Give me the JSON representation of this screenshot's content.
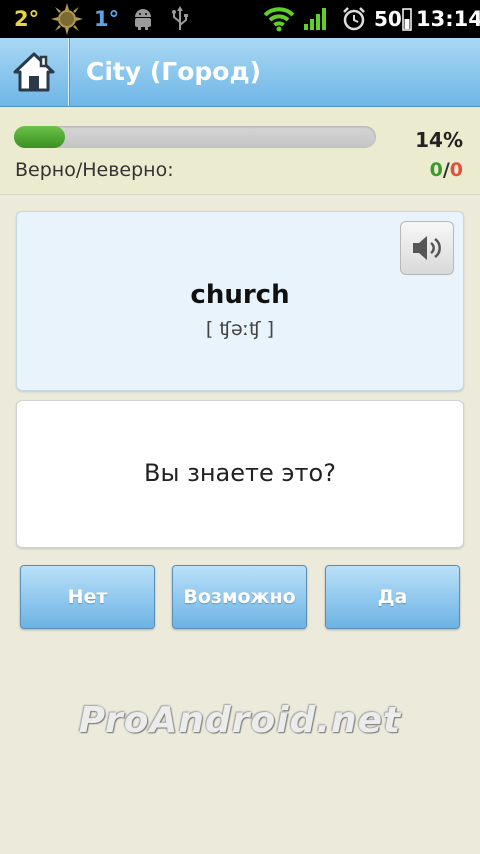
{
  "status_bar": {
    "temp_1": "2°",
    "temp_2": "1°",
    "battery": "50",
    "time": "13:14",
    "icons": [
      "sun-icon",
      "android-icon",
      "usb-icon",
      "wifi-icon",
      "signal-icon",
      "alarm-icon",
      "battery-icon"
    ]
  },
  "header": {
    "title": "City (Город)",
    "home_icon": "home-icon"
  },
  "progress": {
    "fraction": 0.14,
    "percent_label": "14%",
    "score_label": "Верно/Неверно:",
    "correct": "0",
    "separator": "/",
    "wrong": "0"
  },
  "card": {
    "word": "church",
    "transcription": "[ ʧəːʧ ]",
    "sound_icon": "speaker-icon"
  },
  "question": {
    "text": "Вы знаете это?"
  },
  "buttons": {
    "no": "Нет",
    "maybe": "Возможно",
    "yes": "Да"
  },
  "watermark": "ProAndroid.net",
  "colors": {
    "header_blue": "#6fb6e6",
    "progress_green": "#3a9023",
    "correct_green": "#3b9a2d",
    "wrong_red": "#e05040"
  }
}
